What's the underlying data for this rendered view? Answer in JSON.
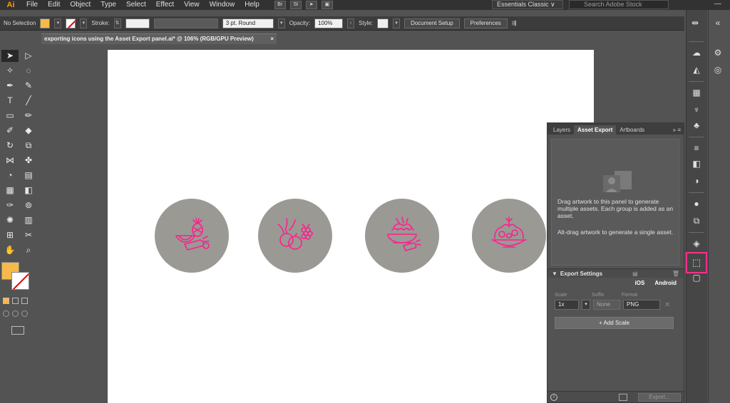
{
  "app": {
    "logo": "Ai"
  },
  "menu": [
    "File",
    "Edit",
    "Object",
    "Type",
    "Select",
    "Effect",
    "View",
    "Window",
    "Help"
  ],
  "menu_buttons": [
    "Br",
    "St"
  ],
  "workspace": "Essentials Classic ∨",
  "stock_search_placeholder": "Search Adobe Stock",
  "control": {
    "selection": "No Selection",
    "stroke_label": "Stroke:",
    "brush": "3 pt. Round",
    "opacity_label": "Opacity:",
    "opacity": "100%",
    "style_label": "Style:",
    "doc_setup": "Document Setup",
    "preferences": "Preferences"
  },
  "document": {
    "tab_title": "exporting icons using the Asset Export panel.ai* @ 106% (RGB/GPU Preview)",
    "close": "×"
  },
  "icons": [
    "fruit-cocktail-icon",
    "berries-icon",
    "salad-bowl-icon",
    "salad-plate-icon"
  ],
  "colors": {
    "accent": "#ff1f8e",
    "circle": "#9a9994",
    "fill": "#f7b94a"
  },
  "panel": {
    "tabs": [
      "Layers",
      "Asset Export",
      "Artboards"
    ],
    "menu": "» ≡",
    "drop_text": "Drag artwork to this panel to generate multiple assets. Each group is added as an asset.",
    "drop_text2": "Alt-drag artwork to generate a single asset.",
    "export_settings": "Export Settings",
    "platforms": [
      "iOS",
      "Android"
    ],
    "col_scale": "Scale",
    "col_suffix": "Suffix",
    "col_format": "Format",
    "scale": "1x",
    "suffix": "None",
    "format": "PNG",
    "add_scale": "Add Scale",
    "export_button": "Export..."
  }
}
